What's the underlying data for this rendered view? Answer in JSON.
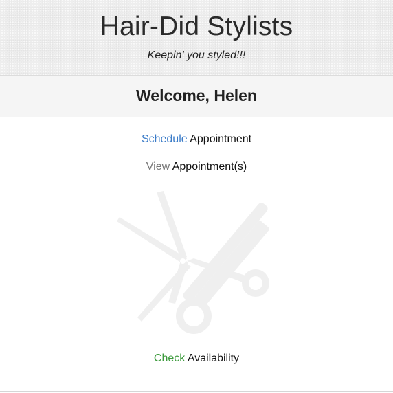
{
  "header": {
    "title": "Hair-Did Stylists",
    "tagline": "Keepin' you styled!!!"
  },
  "welcome": {
    "text": "Welcome, Helen"
  },
  "menu": {
    "schedule": {
      "verb": "Schedule",
      "rest": "Appointment"
    },
    "view": {
      "verb": "View",
      "rest": "Appointment(s)"
    },
    "check": {
      "verb": "Check",
      "rest": "Availability"
    }
  },
  "icons": {
    "watermark": "scissors-comb-icon"
  },
  "colors": {
    "schedule_link": "#3a7bc8",
    "view_link": "#777777",
    "check_link": "#3c9a3c",
    "header_bg": "#f0f0f0",
    "welcome_bg": "#f5f5f5"
  }
}
